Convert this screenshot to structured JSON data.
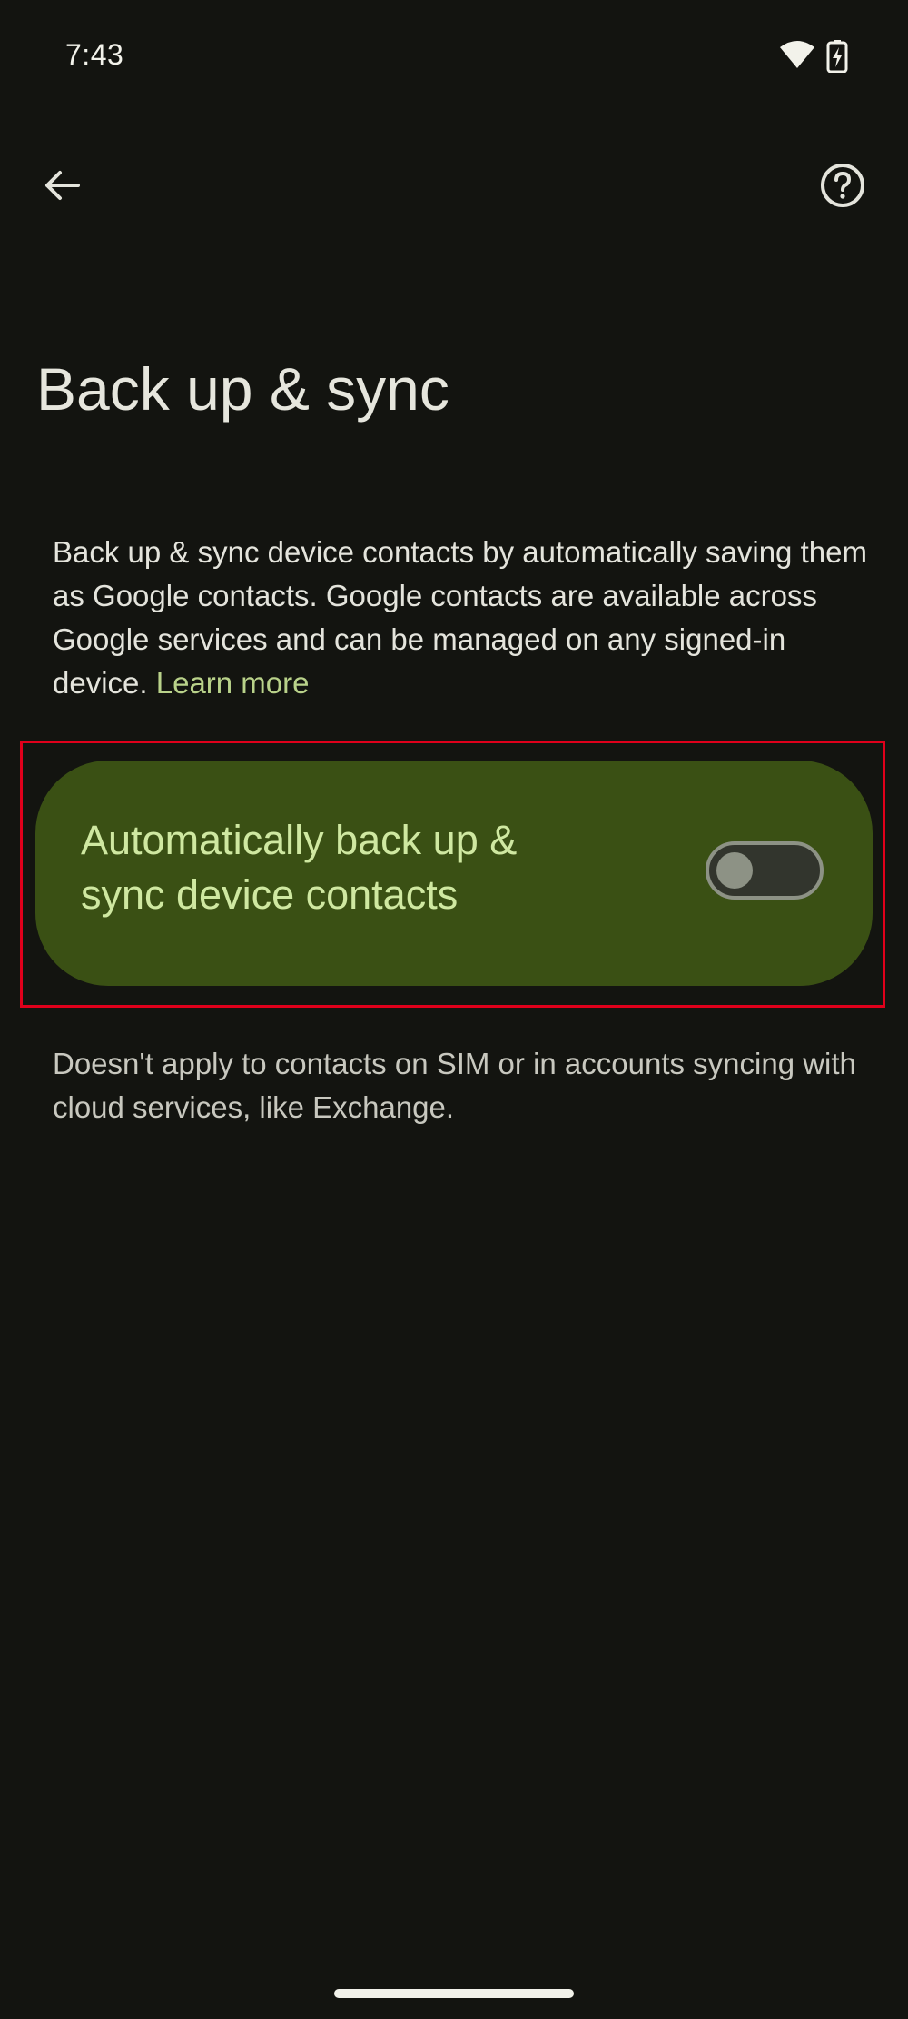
{
  "status_bar": {
    "time": "7:43",
    "icons": [
      "wifi-icon",
      "battery-charging-icon"
    ]
  },
  "app_bar": {
    "back_icon": "arrow-back-icon",
    "help_icon": "help-circle-icon"
  },
  "page": {
    "title": "Back up & sync",
    "description": "Back up & sync device contacts by automatically saving them as Google contacts. Google contacts are available across Google services and can be managed on any signed-in device.",
    "learn_more": "Learn more",
    "footnote": "Doesn't apply to contacts on SIM or in accounts syncing with cloud services, like Exchange."
  },
  "toggle": {
    "label": "Automatically back up & sync device contacts",
    "checked": false
  },
  "colors": {
    "background": "#131410",
    "card": "#3a5014",
    "accent_text": "#cfe8a1",
    "link": "#b9d28a",
    "highlight_border": "#e0001b"
  }
}
